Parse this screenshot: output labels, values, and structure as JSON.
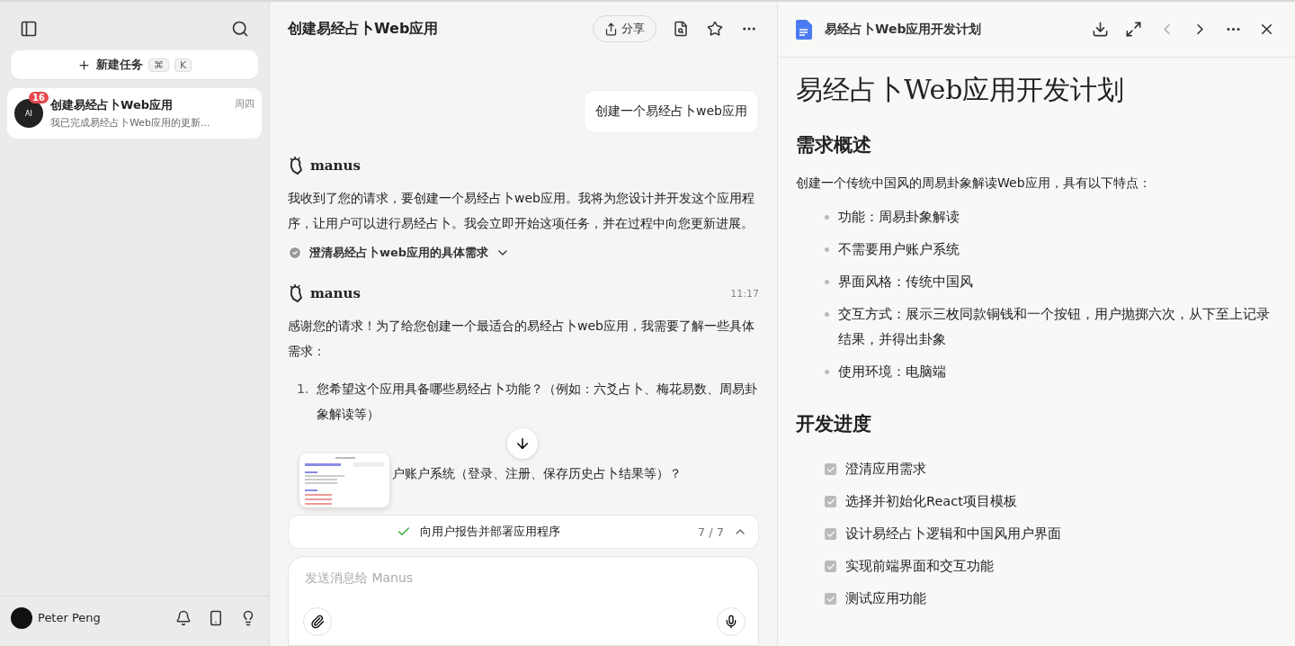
{
  "sidebar": {
    "new_task": {
      "label": "新建任务",
      "shortcut": [
        "⌘",
        "K"
      ]
    },
    "tasks": [
      {
        "title": "创建易经占卜Web应用",
        "preview": "我已完成易经占卜Web应用的更新...",
        "day": "周四",
        "badge": "16",
        "avatar": "AI",
        "selected": true
      }
    ],
    "user": {
      "name": "Peter Peng"
    }
  },
  "chat": {
    "title": "创建易经占卜Web应用",
    "share_label": "分享",
    "messages": [
      {
        "kind": "user",
        "text": "创建一个易经占卜web应用"
      },
      {
        "kind": "assistant",
        "sender": "manus",
        "text": "我收到了您的请求，要创建一个易经占卜web应用。我将为您设计并开发这个应用程序，让用户可以进行易经占卜。我会立即开始这项任务，并在过程中向您更新进展。",
        "step": {
          "label": "澄清易经占卜web应用的具体需求",
          "done": true
        }
      },
      {
        "kind": "assistant",
        "sender": "manus",
        "time": "11:17",
        "text": "感谢您的请求！为了给您创建一个最适合的易经占卜web应用，我需要了解一些具体需求：",
        "list": [
          {
            "number": "1.",
            "text": "您希望这个应用具备哪些易经占卜功能？（例如：六爻占卜、梅花易数、周易卦象解读等）"
          },
          {
            "text": "户账户系统（登录、注册、保存历史占卜结果等）？"
          }
        ]
      }
    ],
    "task_progress": {
      "label": "向用户报告并部署应用程序",
      "count": "7 / 7",
      "done": true
    },
    "input": {
      "placeholder": "发送消息给 Manus"
    }
  },
  "document": {
    "title": "易经占卜Web应用开发计划",
    "heading": "易经占卜Web应用开发计划",
    "sections": [
      {
        "heading": "需求概述",
        "intro": "创建一个传统中国风的周易卦象解读Web应用，具有以下特点：",
        "items": [
          {
            "kind": "bullet",
            "text": "功能：周易卦象解读"
          },
          {
            "kind": "bullet",
            "text": "不需要用户账户系统"
          },
          {
            "kind": "bullet",
            "text": "界面风格：传统中国风"
          },
          {
            "kind": "bullet",
            "text": "交互方式：展示三枚同款铜钱和一个按钮，用户抛掷六次，从下至上记录结果，并得出卦象"
          },
          {
            "kind": "bullet",
            "text": "使用环境：电脑端"
          }
        ]
      },
      {
        "heading": "开发进度",
        "items": [
          {
            "kind": "check",
            "text": "澄清应用需求",
            "checked": true
          },
          {
            "kind": "check",
            "text": "选择并初始化React项目模板",
            "checked": true
          },
          {
            "kind": "check",
            "text": "设计易经占卜逻辑和中国风用户界面",
            "checked": true
          },
          {
            "kind": "check",
            "text": "实现前端界面和交互功能",
            "checked": true
          },
          {
            "kind": "check",
            "text": "测试应用功能",
            "checked": true
          }
        ]
      }
    ]
  }
}
